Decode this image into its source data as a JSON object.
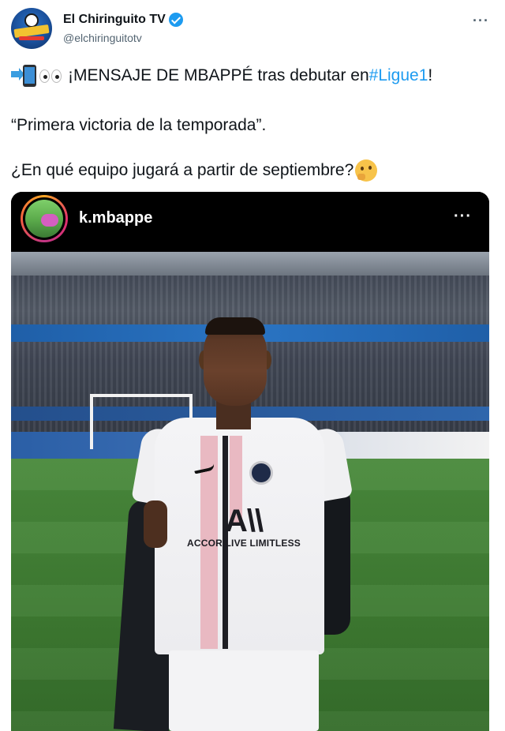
{
  "tweet": {
    "display_name": "El Chiringuito TV",
    "handle": "@elchiringuitotv",
    "more_icon": "more-horizontal-icon",
    "verified": true,
    "accent_color": "#1d9bf0",
    "line1_text": "¡MENSAJE DE MBAPPÉ tras debutar en ",
    "line1_hashtag": "#Ligue1",
    "line1_end": "!",
    "line2": "“Primera victoria de la temporada”.",
    "line3": "¿En qué equipo jugará a partir de septiembre?"
  },
  "embed": {
    "username": "k.mbappe",
    "more_icon": "more-horizontal-icon",
    "sponsor_main": "A\\\\",
    "sponsor_sub": "ACCOR LIVE LIMITLESS"
  }
}
